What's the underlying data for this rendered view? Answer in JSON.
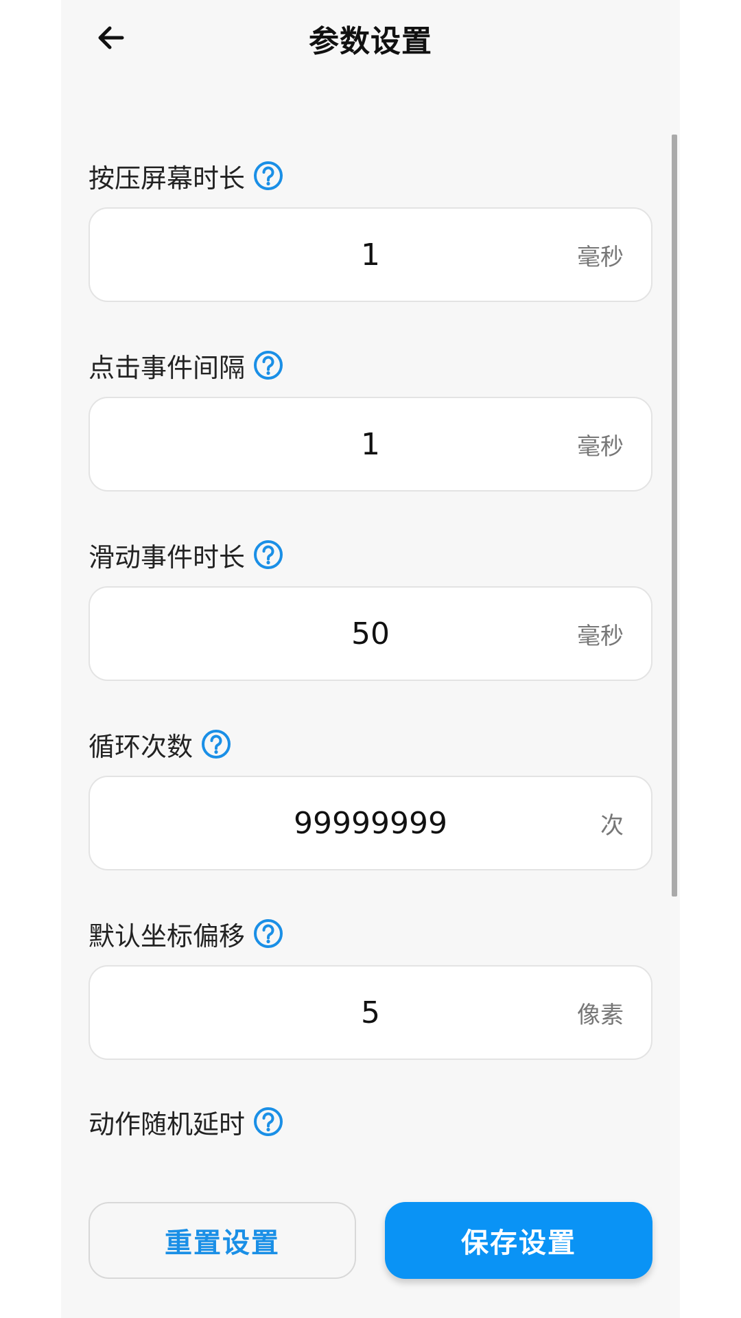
{
  "header": {
    "title": "参数设置",
    "back_icon": "arrow-left-icon"
  },
  "fields": [
    {
      "label": "按压屏幕时长",
      "value": "1",
      "unit": "毫秒"
    },
    {
      "label": "点击事件间隔",
      "value": "1",
      "unit": "毫秒"
    },
    {
      "label": "滑动事件时长",
      "value": "50",
      "unit": "毫秒"
    },
    {
      "label": "循环次数",
      "value": "99999999",
      "unit": "次"
    },
    {
      "label": "默认坐标偏移",
      "value": "5",
      "unit": "像素"
    },
    {
      "label": "动作随机延时"
    }
  ],
  "buttons": {
    "reset_label": "重置设置",
    "save_label": "保存设置"
  },
  "colors": {
    "accent": "#0a93f5",
    "background": "#f7f7f7",
    "reset_text": "#1a8fe6"
  }
}
